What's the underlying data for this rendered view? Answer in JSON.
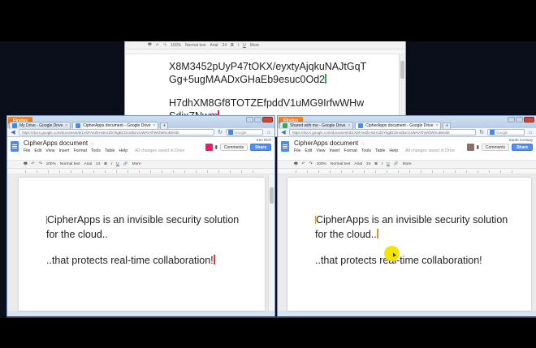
{
  "top_window": {
    "toolbar": {
      "zoom": "100%",
      "style": "Normal text",
      "font": "Arial",
      "size": "24",
      "more": "More"
    },
    "lines": [
      "X8M3452pUyP47tOKX/eyxtyAjqkuNAJtGqT",
      "Gg+5ugMAADxGHaEb9esuc0Od2",
      "H7dhXM8Gf8TOTZEfpddV1uMG9IrfwWHw",
      "SdixZNwm"
    ]
  },
  "left_window": {
    "firefox_label": "Firefox",
    "tabs": [
      {
        "label": "My Drive - Google Drive",
        "color": "#4285f4"
      },
      {
        "label": "CipherApps document - Google Drive",
        "color": "#4a8af4"
      }
    ],
    "url": "https://docs.google.com/document/d/1X0FAeZkHi4HzZbYkgBCDmd5xrcUWAVXhWOWmoBI/edit",
    "search_placeholder": "Google",
    "doc_title": "CipherApps document",
    "menu": [
      "File",
      "Edit",
      "View",
      "Insert",
      "Format",
      "Tools",
      "Table",
      "Help"
    ],
    "saved_status": "All changes saved in Drive",
    "comments_label": "Comments",
    "share_label": "Share",
    "user_name": "Ken Rich",
    "avatar_color": "#e91e63",
    "toolbar": {
      "zoom": "100%",
      "style": "Normal text",
      "font": "Arial",
      "size": "24",
      "more": "More"
    },
    "lines": [
      "CipherApps is an invisible security solution",
      "for the cloud..",
      "..that protects real-time collaboration!"
    ]
  },
  "right_window": {
    "firefox_label": "Firefox",
    "tabs": [
      {
        "label": "Shared with me - Google Drive",
        "color": "#34a853"
      },
      {
        "label": "CipherApps document - Google Drive",
        "color": "#4a8af4"
      }
    ],
    "url": "https://docs.google.com/document/d/1X0FAeZkHi4HzZbYkgBCDmd5xrcUWAVXhWOWmoBI/edit",
    "search_placeholder": "Google",
    "doc_title": "CipherApps document",
    "menu": [
      "File",
      "Edit",
      "View",
      "Insert",
      "Format",
      "Tools",
      "Table",
      "Help"
    ],
    "saved_status": "All changes saved in Drive",
    "comments_label": "Comments",
    "share_label": "Share",
    "user_name": "Sarah Conway",
    "avatar_color": "#8d6e63",
    "toolbar": {
      "zoom": "100%",
      "style": "Normal text",
      "font": "Arial",
      "size": "24",
      "more": "More"
    },
    "lines": [
      "CipherApps is an invisible security solution",
      "for the cloud..",
      "..that protects real-time collaboration!"
    ]
  }
}
